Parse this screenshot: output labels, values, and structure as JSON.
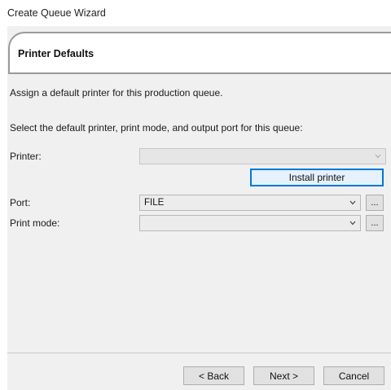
{
  "window": {
    "title": "Create Queue Wizard"
  },
  "header": {
    "title": "Printer Defaults"
  },
  "intro": {
    "line1": "Assign a default printer for this production queue.",
    "line2": "Select the default printer, print mode, and output port for this queue:"
  },
  "form": {
    "printer_label": "Printer:",
    "printer_value": "",
    "install_label": "Install printer",
    "port_label": "Port:",
    "port_value": "FILE",
    "mode_label": "Print mode:",
    "mode_value": "",
    "ellipsis": "..."
  },
  "footer": {
    "back_label": "< Back",
    "next_label": "Next >",
    "cancel_label": "Cancel"
  }
}
